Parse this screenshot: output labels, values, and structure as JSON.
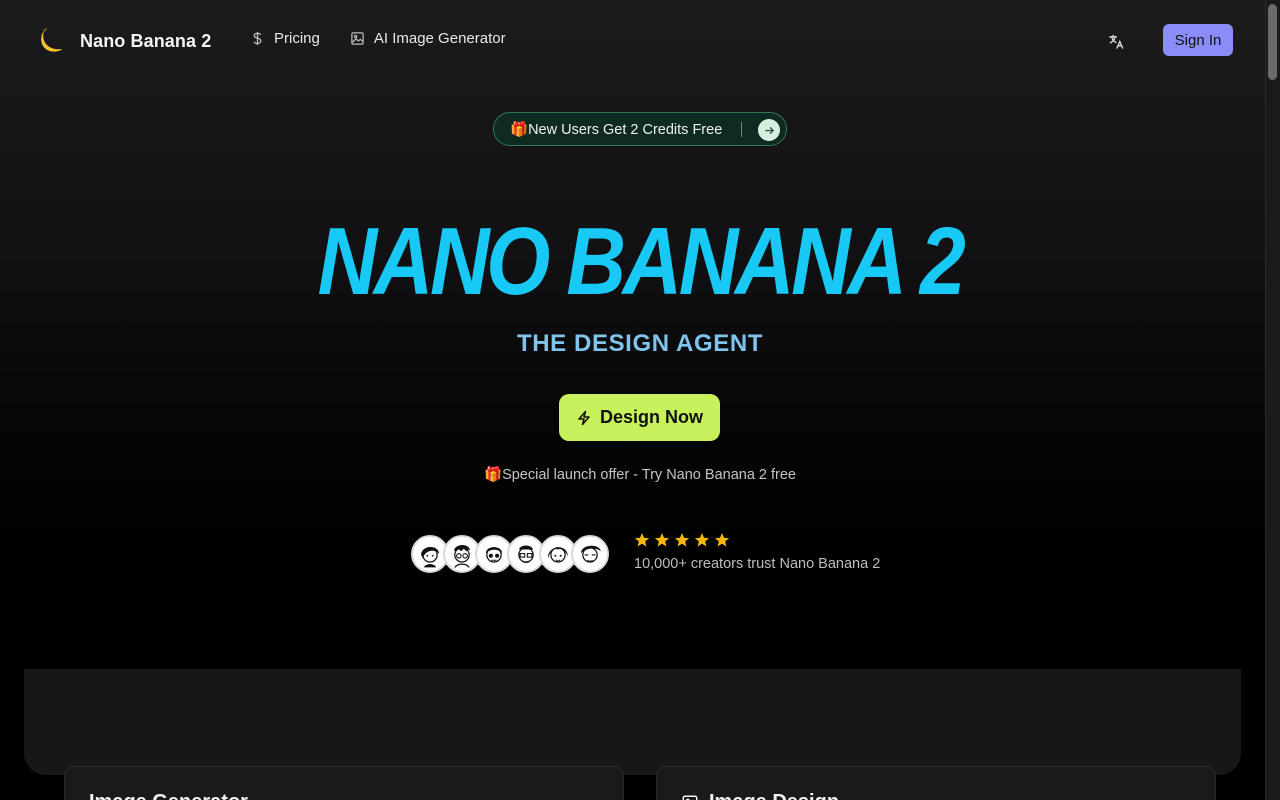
{
  "header": {
    "brand": "Nano Banana 2",
    "nav": [
      {
        "label": "Pricing",
        "icon": "dollar-icon"
      },
      {
        "label": "AI Image Generator",
        "icon": "image-icon"
      }
    ],
    "language_icon": "translate-icon",
    "sign_in": "Sign In"
  },
  "promo": {
    "emoji": "🎁",
    "text": "New Users Get 2 Credits Free",
    "arrow_icon": "arrow-right-icon"
  },
  "hero": {
    "title": "NANO BANANA 2",
    "subtitle": "THE DESIGN AGENT",
    "cta_label": "Design Now",
    "cta_icon": "lightning-icon",
    "offer_emoji": "🎁",
    "offer_text": "Special launch offer - Try Nano Banana 2 free"
  },
  "social_proof": {
    "avatar_count": 6,
    "rating": 5,
    "trust_text": "10,000+ creators trust Nano Banana 2"
  },
  "cards": [
    {
      "title": "Image Generator"
    },
    {
      "title": "Image Design"
    }
  ],
  "colors": {
    "accent_cyan": "#18c9f5",
    "subtitle_blue": "#7fc4ec",
    "cta_lime": "#c7f25c",
    "signin_purple": "#8a8cf7",
    "star_gold": "#f5b80f"
  }
}
